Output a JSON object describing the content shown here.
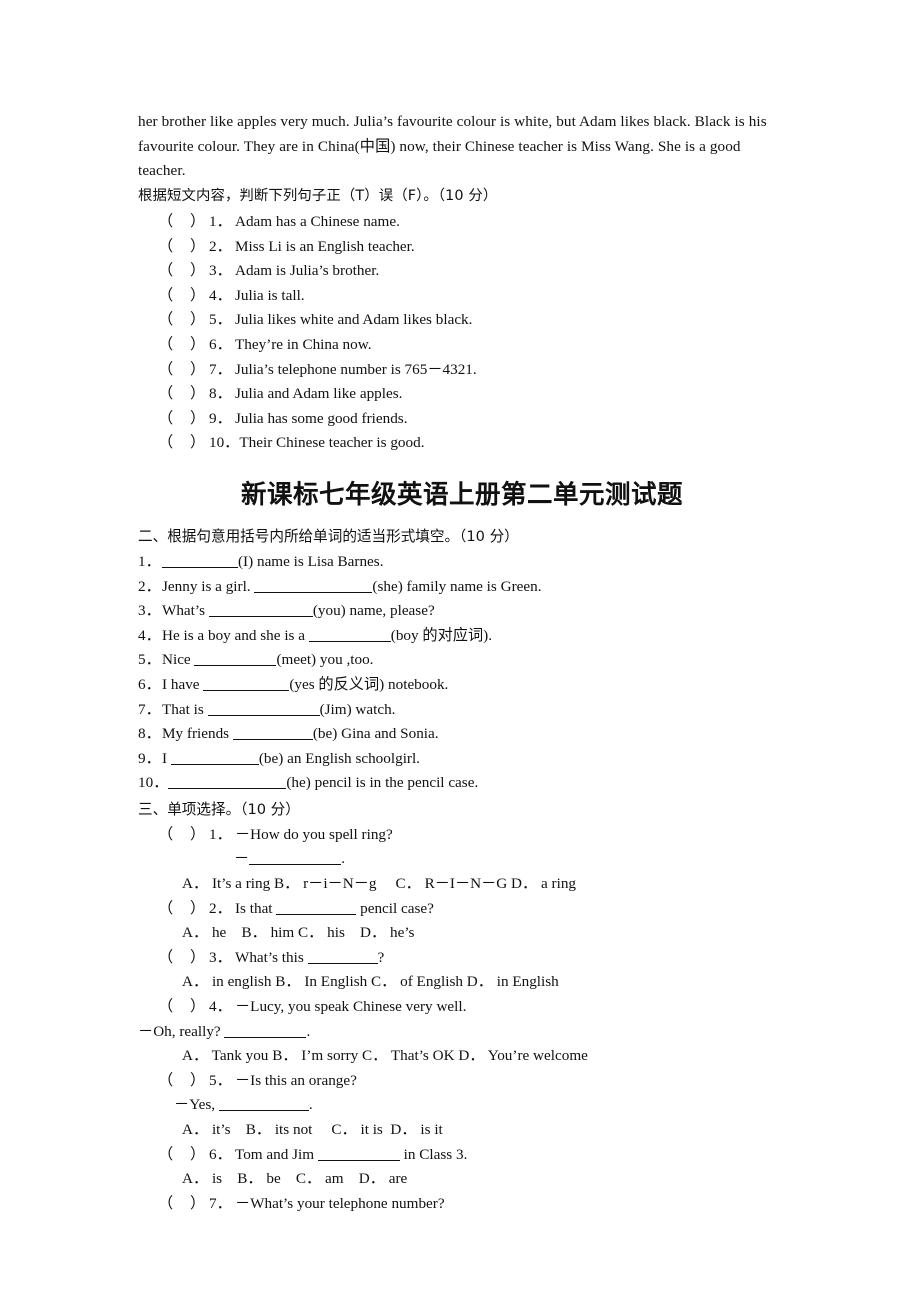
{
  "document": {
    "passage_tail": "her brother like apples very much. Julia’s favourite colour is white, but Adam likes black. Black is his favourite colour. They are in China(中国) now, their Chinese teacher is Miss Wang. She is a good teacher.",
    "tf_instruction": "根据短文内容，判断下列句子正（T）误（F）。（10 分）",
    "title": "新课标七年级英语上册第二单元测试题",
    "section_two_head": "二、根据句意用括号内所给单词的适当形式填空。（10 分）",
    "section_three_head": "三、单项选择。（10 分）"
  },
  "tf_questions": [
    {
      "num": "1．",
      "text": "Adam has a Chinese name."
    },
    {
      "num": "2．",
      "text": "Miss Li is an English teacher."
    },
    {
      "num": "3．",
      "text": "Adam is Julia’s brother."
    },
    {
      "num": "4．",
      "text": "Julia is tall."
    },
    {
      "num": "5．",
      "text": "Julia likes white and Adam likes black."
    },
    {
      "num": "6．",
      "text": "They’re in China now."
    },
    {
      "num": "7．",
      "text": "Julia’s telephone number is 765－4321."
    },
    {
      "num": "8．",
      "text": "Julia and Adam like apples."
    },
    {
      "num": "9．",
      "text": "Julia has some good friends."
    },
    {
      "num": "10．",
      "text": "Their Chinese teacher is good."
    }
  ],
  "fill_questions": [
    {
      "num": "1．",
      "before": "",
      "blank_width": 76,
      "after": "(I) name is Lisa Barnes."
    },
    {
      "num": "2．",
      "before": "Jenny is a girl. ",
      "blank_width": 118,
      "after": "(she) family name is Green."
    },
    {
      "num": "3．",
      "before": "What’s ",
      "blank_width": 104,
      "after": "(you) name, please?"
    },
    {
      "num": "4．",
      "before": "He is a boy and she is a ",
      "blank_width": 82,
      "after": "(boy 的对应词)."
    },
    {
      "num": "5．",
      "before": "Nice ",
      "blank_width": 82,
      "after": "(meet) you ,too."
    },
    {
      "num": "6．",
      "before": "I have ",
      "blank_width": 86,
      "after": "(yes 的反义词) notebook."
    },
    {
      "num": "7．",
      "before": "That is ",
      "blank_width": 112,
      "after": "(Jim) watch."
    },
    {
      "num": "8．",
      "before": "My friends ",
      "blank_width": 80,
      "after": "(be) Gina and Sonia."
    },
    {
      "num": "9．",
      "before": "I ",
      "blank_width": 88,
      "after": "(be) an English schoolgirl."
    },
    {
      "num": "10．",
      "before": "",
      "blank_width": 118,
      "after": "(he) pencil is in the pencil case."
    }
  ],
  "mc_questions": [
    {
      "num": "1．",
      "stem": "－How do you spell ring?",
      "cont": {
        "indent": "deep",
        "before": "－",
        "blank_width": 92,
        "after": "."
      },
      "options": "A． It’s a ring B． r－i－N－g  C． R－I－N－G  D． a ring"
    },
    {
      "num": "2．",
      "stem_before": "Is that ",
      "stem_blank_width": 80,
      "stem_after": " pencil case?",
      "options": "A． he B． him  C． his D． he’s"
    },
    {
      "num": "3．",
      "stem_before": "What’s this ",
      "stem_blank_width": 70,
      "stem_after": "?",
      "options": "A． in english B． In English C． of English D． in English"
    },
    {
      "num": "4．",
      "stem": "－Lucy, you speak Chinese very well.",
      "cont": {
        "indent": "none",
        "before": "－Oh, really? ",
        "blank_width": 82,
        "after": "."
      },
      "options": "A． Tank you B． I’m sorry C． That’s OK D． You’re welcome"
    },
    {
      "num": "5．",
      "stem": "－Is this an orange?",
      "cont": {
        "indent": "small",
        "before": "－Yes, ",
        "blank_width": 90,
        "after": "."
      },
      "options": "A． it’s B． its not  C． it is D． is it"
    },
    {
      "num": "6．",
      "stem_before": "Tom and Jim ",
      "stem_blank_width": 82,
      "stem_after": " in Class 3.",
      "options": "A． is B． be C． am D． are"
    },
    {
      "num": "7．",
      "stem": "－What’s your telephone number?",
      "options": ""
    }
  ]
}
